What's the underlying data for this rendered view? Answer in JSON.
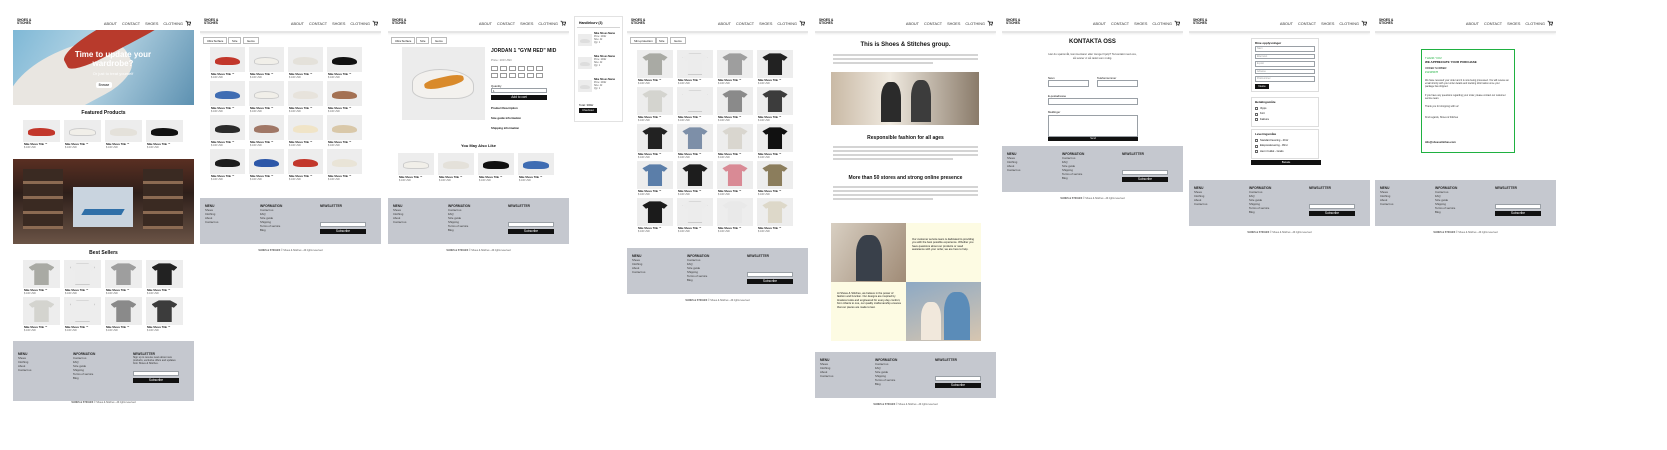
{
  "header": {
    "logo": "SHOES & STICHES",
    "nav": [
      "ABOUT",
      "CONTACT",
      "SHOES",
      "CLOTHING"
    ]
  },
  "product": {
    "name": "Nike Shoes Title ™",
    "price": "$ 100 USD"
  },
  "home": {
    "hero_title": "Time to update your wardrobe?",
    "hero_sub": "Or just to treat yourself",
    "hero_button": "Browse",
    "featured_title": "Featured Products",
    "bestsellers_title": "Best Sellers"
  },
  "filters": [
    "Ultra Surface",
    "Size",
    "Genre"
  ],
  "clothing_filters": [
    "Slim-protection",
    "Size",
    "Genre"
  ],
  "pdp": {
    "title": "JORDAN 1 \"GYM RED\" MID",
    "price": "Price: 100 USD",
    "quantity_label": "Quantity",
    "quantity_value": "1",
    "add_button": "Add to cart",
    "links": [
      "Product Description",
      "Size guide information",
      "Shipping information"
    ],
    "related_title": "You May Also Like"
  },
  "cart": {
    "title": "Handlekurv (3)",
    "items": [
      {
        "name": "Nike Shoes Name",
        "meta": "Price: 100kr\nSize: 42\nQty: 1"
      },
      {
        "name": "Nike Shoes Name",
        "meta": "Price: 100kr\nSize: 42\nQty: 1"
      },
      {
        "name": "Nike Shoes Name",
        "meta": "Price: 100kr\nSize: 42\nQty: 1"
      }
    ],
    "total": "Total: 300kr",
    "checkout": "Checkout"
  },
  "about": {
    "title": "This is Shoes & Stitches group.",
    "h2": "Responsible fashion for all ages",
    "h3": "More than 50 stores and strong online presence",
    "quote1": "Our customer service team is dedicated to providing you with the best possible experience. Whether you have questions about our products or need assistance with your order, we are here to help.",
    "quote2": "At Shoes & Stitches, we believe in the power of fashion and function. Our designs are inspired by timeless looks and engineered for every-day comfort, from infants to one, our quality craftsmanship ensures that our pieces are made to last."
  },
  "contact": {
    "title": "KONTAKTA OSS",
    "intro": "Har du spørsmål, kommentarer eller trenger hjelp? Ta kontakt med oss, så svarer vi så raskt som mulig.",
    "fields": [
      "Navn",
      "Telefonnummer",
      "E-postadresse",
      "Meldinger"
    ],
    "send": "Send"
  },
  "checkout": {
    "section1": "Dine opplysninger",
    "placeholders": [
      "Navn",
      "Etternavn",
      "E-post",
      "Adresse",
      "Postnummer"
    ],
    "next": "Neste",
    "section2": "Betalingsmåte",
    "payments": [
      "Vipps",
      "Kort",
      "Faktura"
    ],
    "section3": "Leveringsmåte",
    "shipping": [
      "Standard levering - 49 kr",
      "Ekspresslevering - 99 kr",
      "Hent i butikk - Gratis"
    ],
    "pay": "Betale"
  },
  "confirm": {
    "thanks": "THANK YOU!",
    "heading": "WE APPRECIATE YOUR PURCHASE",
    "order_label": "ORDER NUMBER:",
    "order": "#12345678",
    "lines": [
      "We have received your order and it is now being processed. You will receive an email shortly with your order details and tracking information once your package has shipped.",
      "If you have any questions regarding your order, please contact our customer service team.",
      "Thank you for shopping with us!",
      "Kind regards, Shoes & Stitches"
    ],
    "email": "info@shoesstitches.com"
  },
  "footer": {
    "col1_title": "MENU",
    "col1": "Shoes\nClothing\nAbout\nContact us",
    "col2_title": "INFORMATION",
    "col2": "Contact us\nFAQ\nSize guide\nShipping\nTerms of service\nBlog",
    "col3_title": "NEWSLETTER",
    "col3": "Sign up to receive news about new products, exclusive offers and updates from Shoes & Stitches.",
    "email_placeholder": "Enter your email",
    "subscribe": "Subscribe",
    "copyright": "© Shoes & Stitches - All rights reserved"
  },
  "colors": {
    "footer": "#c5c8cf",
    "accent": "#111111",
    "success": "#1fb141",
    "highlight": "#fdfbe3"
  }
}
